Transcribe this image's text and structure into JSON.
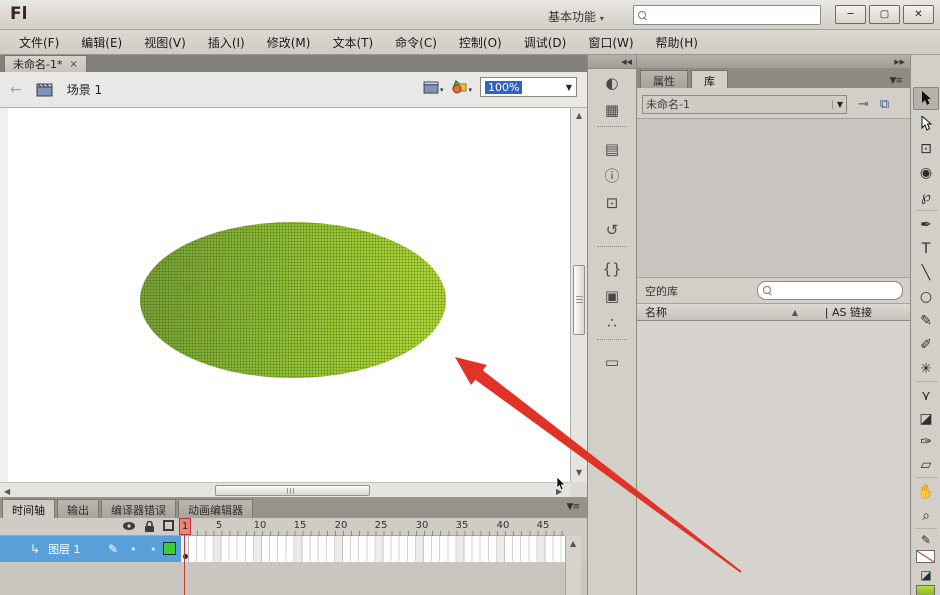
{
  "titlebar": {
    "logo": "Fl",
    "workspace_button": "基本功能",
    "workspace_caret": "▾",
    "minimize": "─",
    "maximize": "▢",
    "close": "✕"
  },
  "menubar": {
    "items": [
      "文件(F)",
      "编辑(E)",
      "视图(V)",
      "插入(I)",
      "修改(M)",
      "文本(T)",
      "命令(C)",
      "控制(O)",
      "调试(D)",
      "窗口(W)",
      "帮助(H)"
    ]
  },
  "document": {
    "tab_title": "未命名-1*",
    "tab_close": "×",
    "back_arrow": "←",
    "scene_label": "场景 1",
    "zoom_value": "100%",
    "zoom_caret": "▼"
  },
  "panels": {
    "collapse_left": "◀◀",
    "collapse_right": "▶▶",
    "menu_glyph": "▼≡"
  },
  "dock": {
    "icons": [
      {
        "name": "color-palette-icon",
        "glyph": "◐"
      },
      {
        "name": "swatches-icon",
        "glyph": "▦"
      },
      {
        "name": "align-icon",
        "glyph": "▤"
      },
      {
        "name": "info-icon",
        "glyph": "ⓘ"
      },
      {
        "name": "transform-icon",
        "glyph": "⊡"
      },
      {
        "name": "history-icon",
        "glyph": "↺"
      },
      {
        "name": "code-snippets-icon",
        "glyph": "{}"
      },
      {
        "name": "components-icon",
        "glyph": "▣"
      },
      {
        "name": "motion-presets-icon",
        "glyph": "∴"
      },
      {
        "name": "project-icon",
        "glyph": "▭"
      }
    ]
  },
  "library": {
    "tab_properties": "属性",
    "tab_library": "库",
    "doc_name": "未命名-1",
    "dropdown_caret": "▼",
    "pin_glyph": "⊸",
    "new_panel_glyph": "⧉",
    "empty_label": "空的库",
    "name_column": "名称",
    "sort_glyph": "▲",
    "linkage_column": "| AS 链接"
  },
  "timeline": {
    "tab_timeline": "时间轴",
    "tab_output": "输出",
    "tab_compiler_errors": "编译器错误",
    "tab_motion_editor": "动画编辑器",
    "playhead_frame": "1",
    "ruler": [
      "5",
      "10",
      "15",
      "20",
      "25",
      "30",
      "35",
      "40",
      "45"
    ],
    "layer_icon": "↳",
    "layer_name": "图层 1",
    "pencil_glyph": "✎",
    "dot_glyph": "•",
    "outline_glyph": "■"
  },
  "tools": {
    "free_transform": "⊡",
    "rotation_3d": "◉",
    "lasso": "℘",
    "pen": "✒",
    "text": "T",
    "line": "╲",
    "oval": "○",
    "pencil": "✎",
    "brush": "✐",
    "spray_brush": "✳",
    "bone": "⋎",
    "paint_bucket": "◪",
    "eyedropper": "✑",
    "eraser": "▱",
    "hand": "✋",
    "zoom": "⌕",
    "stroke_glyph": "✎",
    "fill_glyph": "◪"
  },
  "colors": {
    "ellipse_left": "#79a236",
    "ellipse_right": "#a9d334",
    "arrow_red": "#e03226",
    "layer_selected_blue": "#5aa0d8",
    "outline_swatch_green": "#3ecb3e",
    "zoom_selection_blue": "#3162c4"
  }
}
